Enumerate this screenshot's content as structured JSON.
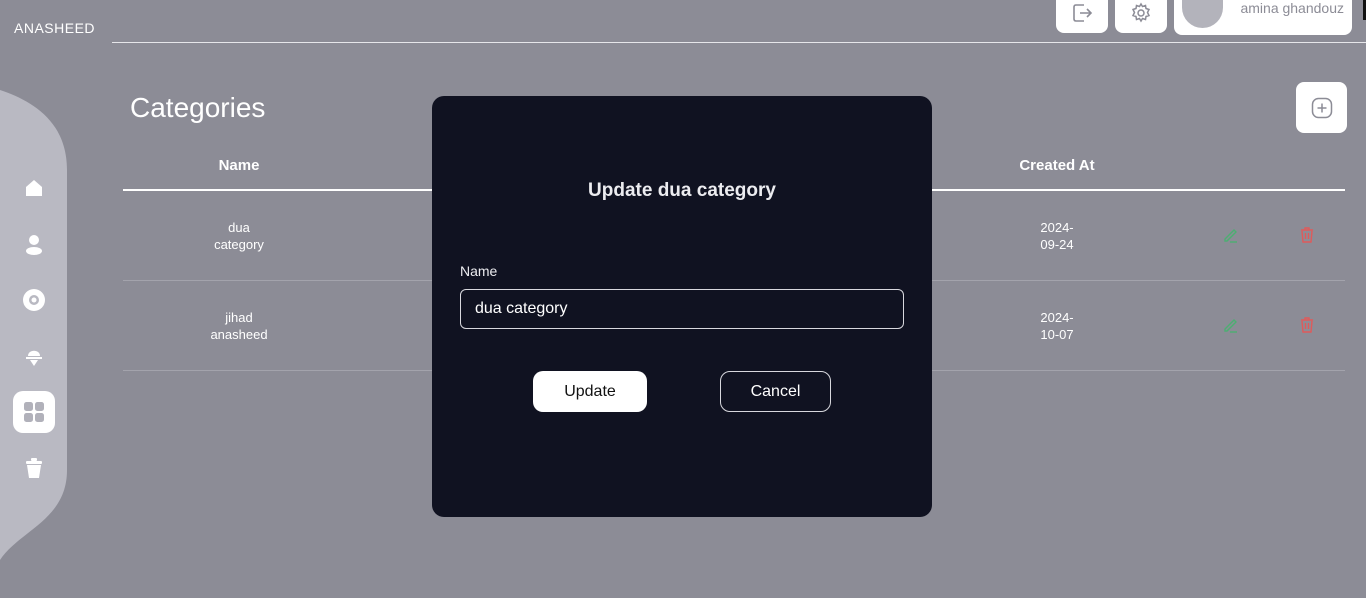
{
  "app": {
    "brand": "ANASHEED"
  },
  "header": {
    "user_name": "amina ghandouz"
  },
  "sidebar": {
    "items": [
      {
        "name": "home-icon",
        "active": false
      },
      {
        "name": "user-icon",
        "active": false
      },
      {
        "name": "disc-icon",
        "active": false
      },
      {
        "name": "microphone-icon",
        "active": false
      },
      {
        "name": "categories-grid-icon",
        "active": true
      },
      {
        "name": "trash-icon",
        "active": false
      }
    ]
  },
  "page": {
    "title": "Categories"
  },
  "table": {
    "columns": [
      "Name",
      "Created At"
    ],
    "rows": [
      {
        "name_line1": "dua",
        "name_line2": "category",
        "date_line1": "2024-",
        "date_line2": "09-24"
      },
      {
        "name_line1": "jihad",
        "name_line2": "anasheed",
        "date_line1": "2024-",
        "date_line2": "10-07"
      }
    ]
  },
  "modal": {
    "title": "Update dua category",
    "field_label": "Name",
    "field_value": "dua category",
    "update_label": "Update",
    "cancel_label": "Cancel"
  },
  "colors": {
    "background": "#8c8c96",
    "modal_bg": "#101221",
    "edit_green": "#4caf72",
    "delete_red": "#e05a5a"
  }
}
